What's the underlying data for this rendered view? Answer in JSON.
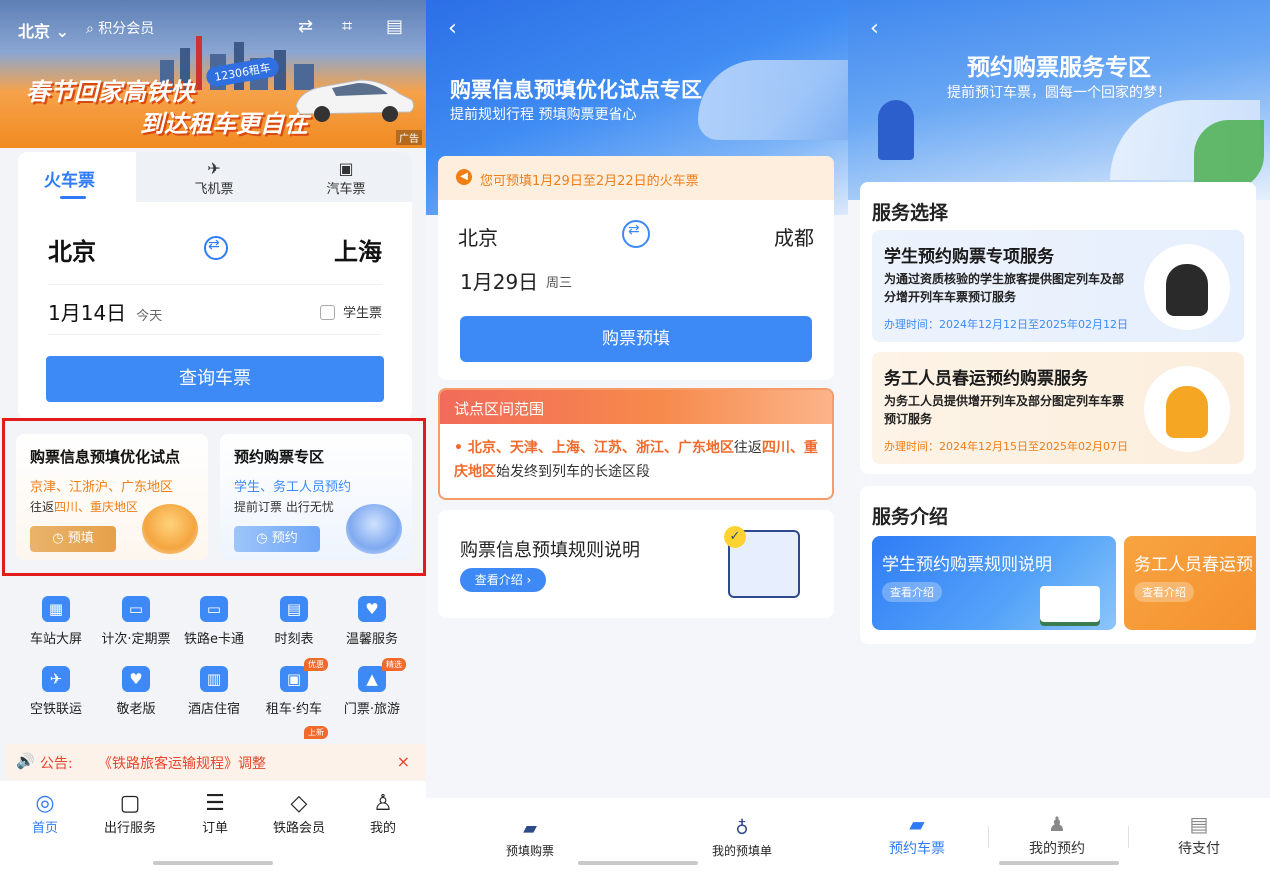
{
  "panel1": {
    "city": "北京",
    "search_label": "积分会员",
    "banner": {
      "headline1": "春节回家高铁快",
      "headline2": "到达租车更自在",
      "tag": "12306租车",
      "ad_label": "广告"
    },
    "tabs": [
      {
        "label": "火车票",
        "icon": "train-icon",
        "active": true
      },
      {
        "label": "飞机票",
        "icon": "plane-icon"
      },
      {
        "label": "汽车票",
        "icon": "bus-icon"
      }
    ],
    "from_city": "北京",
    "to_city": "上海",
    "date": "1月14日",
    "date_hint": "今天",
    "student_label": "学生票",
    "query_button": "查询车票",
    "promo_left": {
      "title": "购票信息预填优化试点",
      "line1_orange": "京津、江浙沪、广东地区",
      "line2_prefix": "往返",
      "line2_orange": "四川、重庆地区",
      "button": "预填"
    },
    "promo_right": {
      "title": "预约购票专区",
      "line1_blue": "学生、务工人员预约",
      "line2": "提前订票 出行无忧",
      "button": "预约"
    },
    "grid": [
      {
        "label": "车站大屏",
        "icon": "station-screen-icon",
        "glyph": "▦"
      },
      {
        "label": "计次·定期票",
        "icon": "periodic-ticket-icon",
        "glyph": "⌕"
      },
      {
        "label": "铁路e卡通",
        "icon": "ecard-icon",
        "glyph": "▭"
      },
      {
        "label": "时刻表",
        "icon": "timetable-icon",
        "glyph": "▤"
      },
      {
        "label": "温馨服务",
        "icon": "care-service-icon",
        "glyph": "♥"
      },
      {
        "label": "空铁联运",
        "icon": "air-rail-icon",
        "glyph": "✈"
      },
      {
        "label": "敬老版",
        "icon": "elder-mode-icon",
        "glyph": "♥"
      },
      {
        "label": "酒店住宿",
        "icon": "hotel-icon",
        "glyph": "▥"
      },
      {
        "label": "租车·约车",
        "icon": "car-rental-icon",
        "glyph": "▣",
        "badge": "优惠"
      },
      {
        "label": "门票·旅游",
        "icon": "tourism-icon",
        "glyph": "▲",
        "badge": "精选"
      }
    ],
    "partial_badge": "上新",
    "notice_label": "公告:",
    "notice_text": "《铁路旅客运输规程》调整",
    "nav": [
      {
        "label": "首页",
        "icon": "home-icon",
        "glyph": "◎",
        "active": true
      },
      {
        "label": "出行服务",
        "icon": "luggage-icon",
        "glyph": "▢"
      },
      {
        "label": "订单",
        "icon": "order-icon",
        "glyph": "☰"
      },
      {
        "label": "铁路会员",
        "icon": "member-diamond-icon",
        "glyph": "◇"
      },
      {
        "label": "我的",
        "icon": "profile-icon",
        "glyph": "♙"
      }
    ]
  },
  "panel2": {
    "title": "购票信息预填优化试点专区",
    "subtitle": "提前规划行程 预填购票更省心",
    "tip": "您可预填1月29日至2月22日的火车票",
    "from_city": "北京",
    "to_city": "成都",
    "date": "1月29日",
    "weekday": "周三",
    "fill_button": "购票预填",
    "scope_title": "试点区间范围",
    "scope_hl1": "北京、天津、上海、江苏、浙江、广东地区",
    "scope_mid": "往返",
    "scope_hl2": "四川、重庆地区",
    "scope_tail": "始发终到列车的长途区段",
    "rules_title": "购票信息预填规则说明",
    "rules_button": "查看介绍 ›",
    "nav": [
      {
        "label": "预填购票",
        "icon": "prefill-ticket-icon",
        "glyph": "▰"
      },
      {
        "label": "我的预填单",
        "icon": "my-prefill-icon",
        "glyph": "♁"
      }
    ]
  },
  "panel3": {
    "title": "预约购票服务专区",
    "subtitle": "提前预订车票，圆每一个回家的梦！",
    "service_select": "服务选择",
    "services": [
      {
        "name": "学生预约购票专项服务",
        "desc": "为通过资质核验的学生旅客提供图定列车及部分增开列车车票预订服务",
        "time": "办理时间：2024年12月12日至2025年02月12日"
      },
      {
        "name": "务工人员春运预约购票服务",
        "desc": "为务工人员提供增开列车及部分图定列车车票预订服务",
        "time": "办理时间：2024年12月15日至2025年02月07日"
      }
    ],
    "service_intro": "服务介绍",
    "intros": [
      {
        "name": "学生预约购票规则说明",
        "button": "查看介绍"
      },
      {
        "name": "务工人员春运预",
        "button": "查看介绍"
      }
    ],
    "nav": [
      {
        "label": "预约车票",
        "icon": "reserve-ticket-icon",
        "glyph": "▰",
        "active": true
      },
      {
        "label": "我的预约",
        "icon": "my-reservation-icon",
        "glyph": "♟"
      },
      {
        "label": "待支付",
        "icon": "pending-payment-icon",
        "glyph": "▤"
      }
    ]
  }
}
